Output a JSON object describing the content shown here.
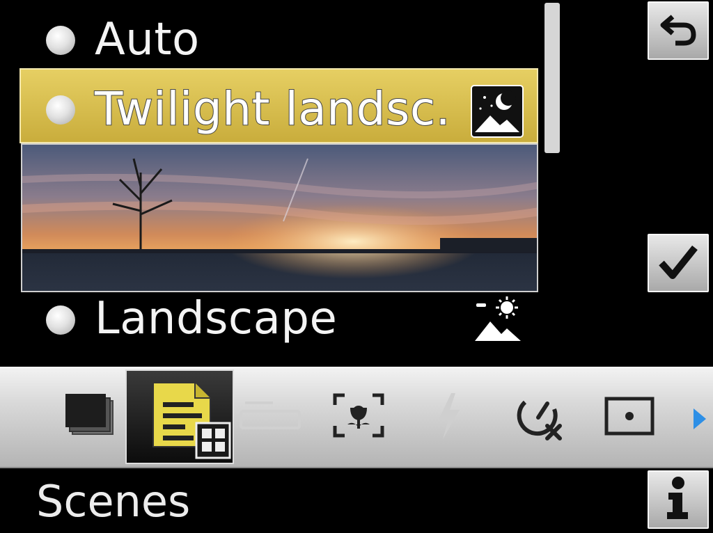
{
  "scene_list": {
    "items": [
      {
        "label": "Auto"
      },
      {
        "label": "Twilight landsc.",
        "icon": "twilight-landscape-icon",
        "selected": true
      },
      {
        "label": "Landscape",
        "icon": "landscape-icon"
      }
    ]
  },
  "side_buttons": {
    "back": {
      "icon": "back-arrow-icon"
    },
    "confirm": {
      "icon": "checkmark-icon"
    },
    "info": {
      "icon": "info-icon"
    }
  },
  "toolbar": {
    "tools": [
      {
        "icon": "drive-mode-icon"
      },
      {
        "icon": "scene-mode-icon",
        "active": true
      },
      {
        "icon": "image-size-icon",
        "enabled": false
      },
      {
        "icon": "macro-focus-icon"
      },
      {
        "icon": "flash-icon",
        "enabled": false
      },
      {
        "icon": "self-timer-off-icon"
      },
      {
        "icon": "metering-icon"
      },
      {
        "icon": "next-arrow-icon"
      }
    ],
    "accent": "#2d8fe6"
  },
  "footer": {
    "title": "Scenes"
  },
  "colors": {
    "selection": "#d8bd4c",
    "background": "#000000"
  }
}
